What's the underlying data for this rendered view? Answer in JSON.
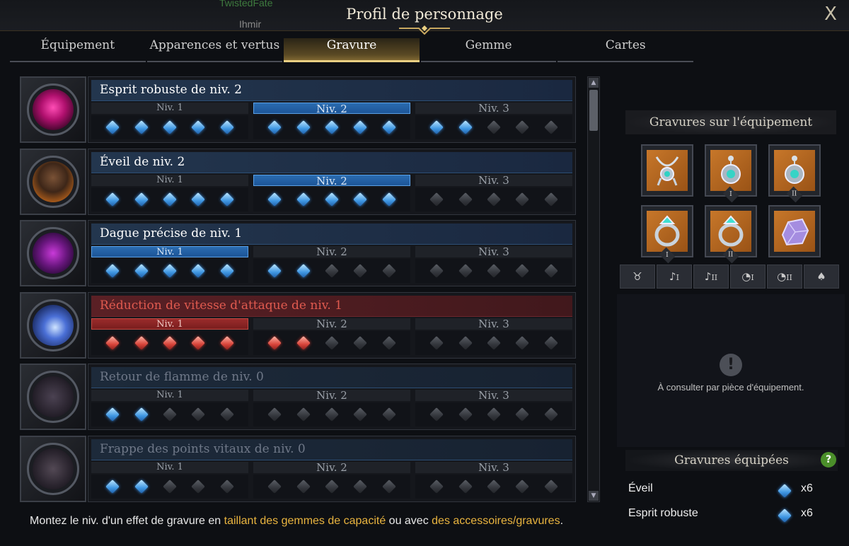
{
  "background_names": [
    "TwistedFate",
    "Ihmir"
  ],
  "window": {
    "title": "Profil de personnage",
    "close": "X"
  },
  "tabs": [
    {
      "label": "Équipement"
    },
    {
      "label": "Apparences et vertus"
    },
    {
      "label": "Gravure",
      "active": true
    },
    {
      "label": "Gemme"
    },
    {
      "label": "Cartes"
    }
  ],
  "engravings": [
    {
      "name": "Esprit robuste de niv. 2",
      "style": "normal",
      "active_level": 2,
      "levels": [
        "Niv. 1",
        "Niv. 2",
        "Niv. 3"
      ],
      "filled": 12,
      "gem_color": "blue",
      "icon": "skull-icon"
    },
    {
      "name": "Éveil de niv. 2",
      "style": "normal",
      "active_level": 2,
      "levels": [
        "Niv. 1",
        "Niv. 2",
        "Niv. 3"
      ],
      "filled": 10,
      "gem_color": "blue",
      "icon": "warrior-portrait-icon"
    },
    {
      "name": "Dague précise de niv. 1",
      "style": "normal",
      "active_level": 1,
      "levels": [
        "Niv. 1",
        "Niv. 2",
        "Niv. 3"
      ],
      "filled": 7,
      "gem_color": "blue",
      "icon": "dagger-icon"
    },
    {
      "name": "Réduction de vitesse d'attaque de niv. 1",
      "style": "red",
      "active_level": 1,
      "levels": [
        "Niv. 1",
        "Niv. 2",
        "Niv. 3"
      ],
      "filled": 7,
      "gem_color": "red",
      "icon": "chain-icon"
    },
    {
      "name": "Retour de flamme de niv. 0",
      "style": "dim",
      "active_level": 0,
      "levels": [
        "Niv. 1",
        "Niv. 2",
        "Niv. 3"
      ],
      "filled": 2,
      "gem_color": "blue",
      "icon": "shadow-icon"
    },
    {
      "name": "Frappe des points vitaux de niv. 0",
      "style": "dim",
      "active_level": 0,
      "levels": [
        "Niv. 1",
        "Niv. 2",
        "Niv. 3"
      ],
      "filled": 2,
      "gem_color": "blue",
      "icon": "shadow-fist-icon"
    }
  ],
  "footnote": {
    "part1": "Montez le niv. d'un effet de gravure en ",
    "link1": "taillant des gemmes de capacité",
    "part2": " ou avec ",
    "link2": "des accessoires/gravures",
    "part3": "."
  },
  "right_panel": {
    "title": "Gravures sur l'équipement",
    "slots": [
      {
        "name": "necklace",
        "icon": "necklace-icon",
        "roman": ""
      },
      {
        "name": "earring-1",
        "icon": "earring-icon",
        "roman": "I"
      },
      {
        "name": "earring-2",
        "icon": "earring-icon",
        "roman": "II"
      },
      {
        "name": "ring-1",
        "icon": "ring-icon",
        "roman": "I"
      },
      {
        "name": "ring-2",
        "icon": "ring-icon",
        "roman": "II"
      },
      {
        "name": "stone",
        "icon": "ability-stone-icon",
        "roman": ""
      }
    ],
    "filters": [
      {
        "icon": "necklace-icon",
        "label": ""
      },
      {
        "icon": "earring-icon",
        "label": "I"
      },
      {
        "icon": "earring-icon",
        "label": "II"
      },
      {
        "icon": "ring-icon",
        "label": "I"
      },
      {
        "icon": "ring-icon",
        "label": "II"
      },
      {
        "icon": "stone-icon",
        "label": ""
      }
    ],
    "info": "À consulter par pièce d'équipement.",
    "equipped_title": "Gravures équipées",
    "equipped": [
      {
        "name": "Éveil",
        "count": "x6"
      },
      {
        "name": "Esprit robuste",
        "count": "x6"
      }
    ]
  },
  "colors": {
    "accent_gold": "#e9cf83",
    "active_blue": "#2a6cb0",
    "penalty_red": "#c24a43",
    "link_gold": "#e9b43f"
  }
}
